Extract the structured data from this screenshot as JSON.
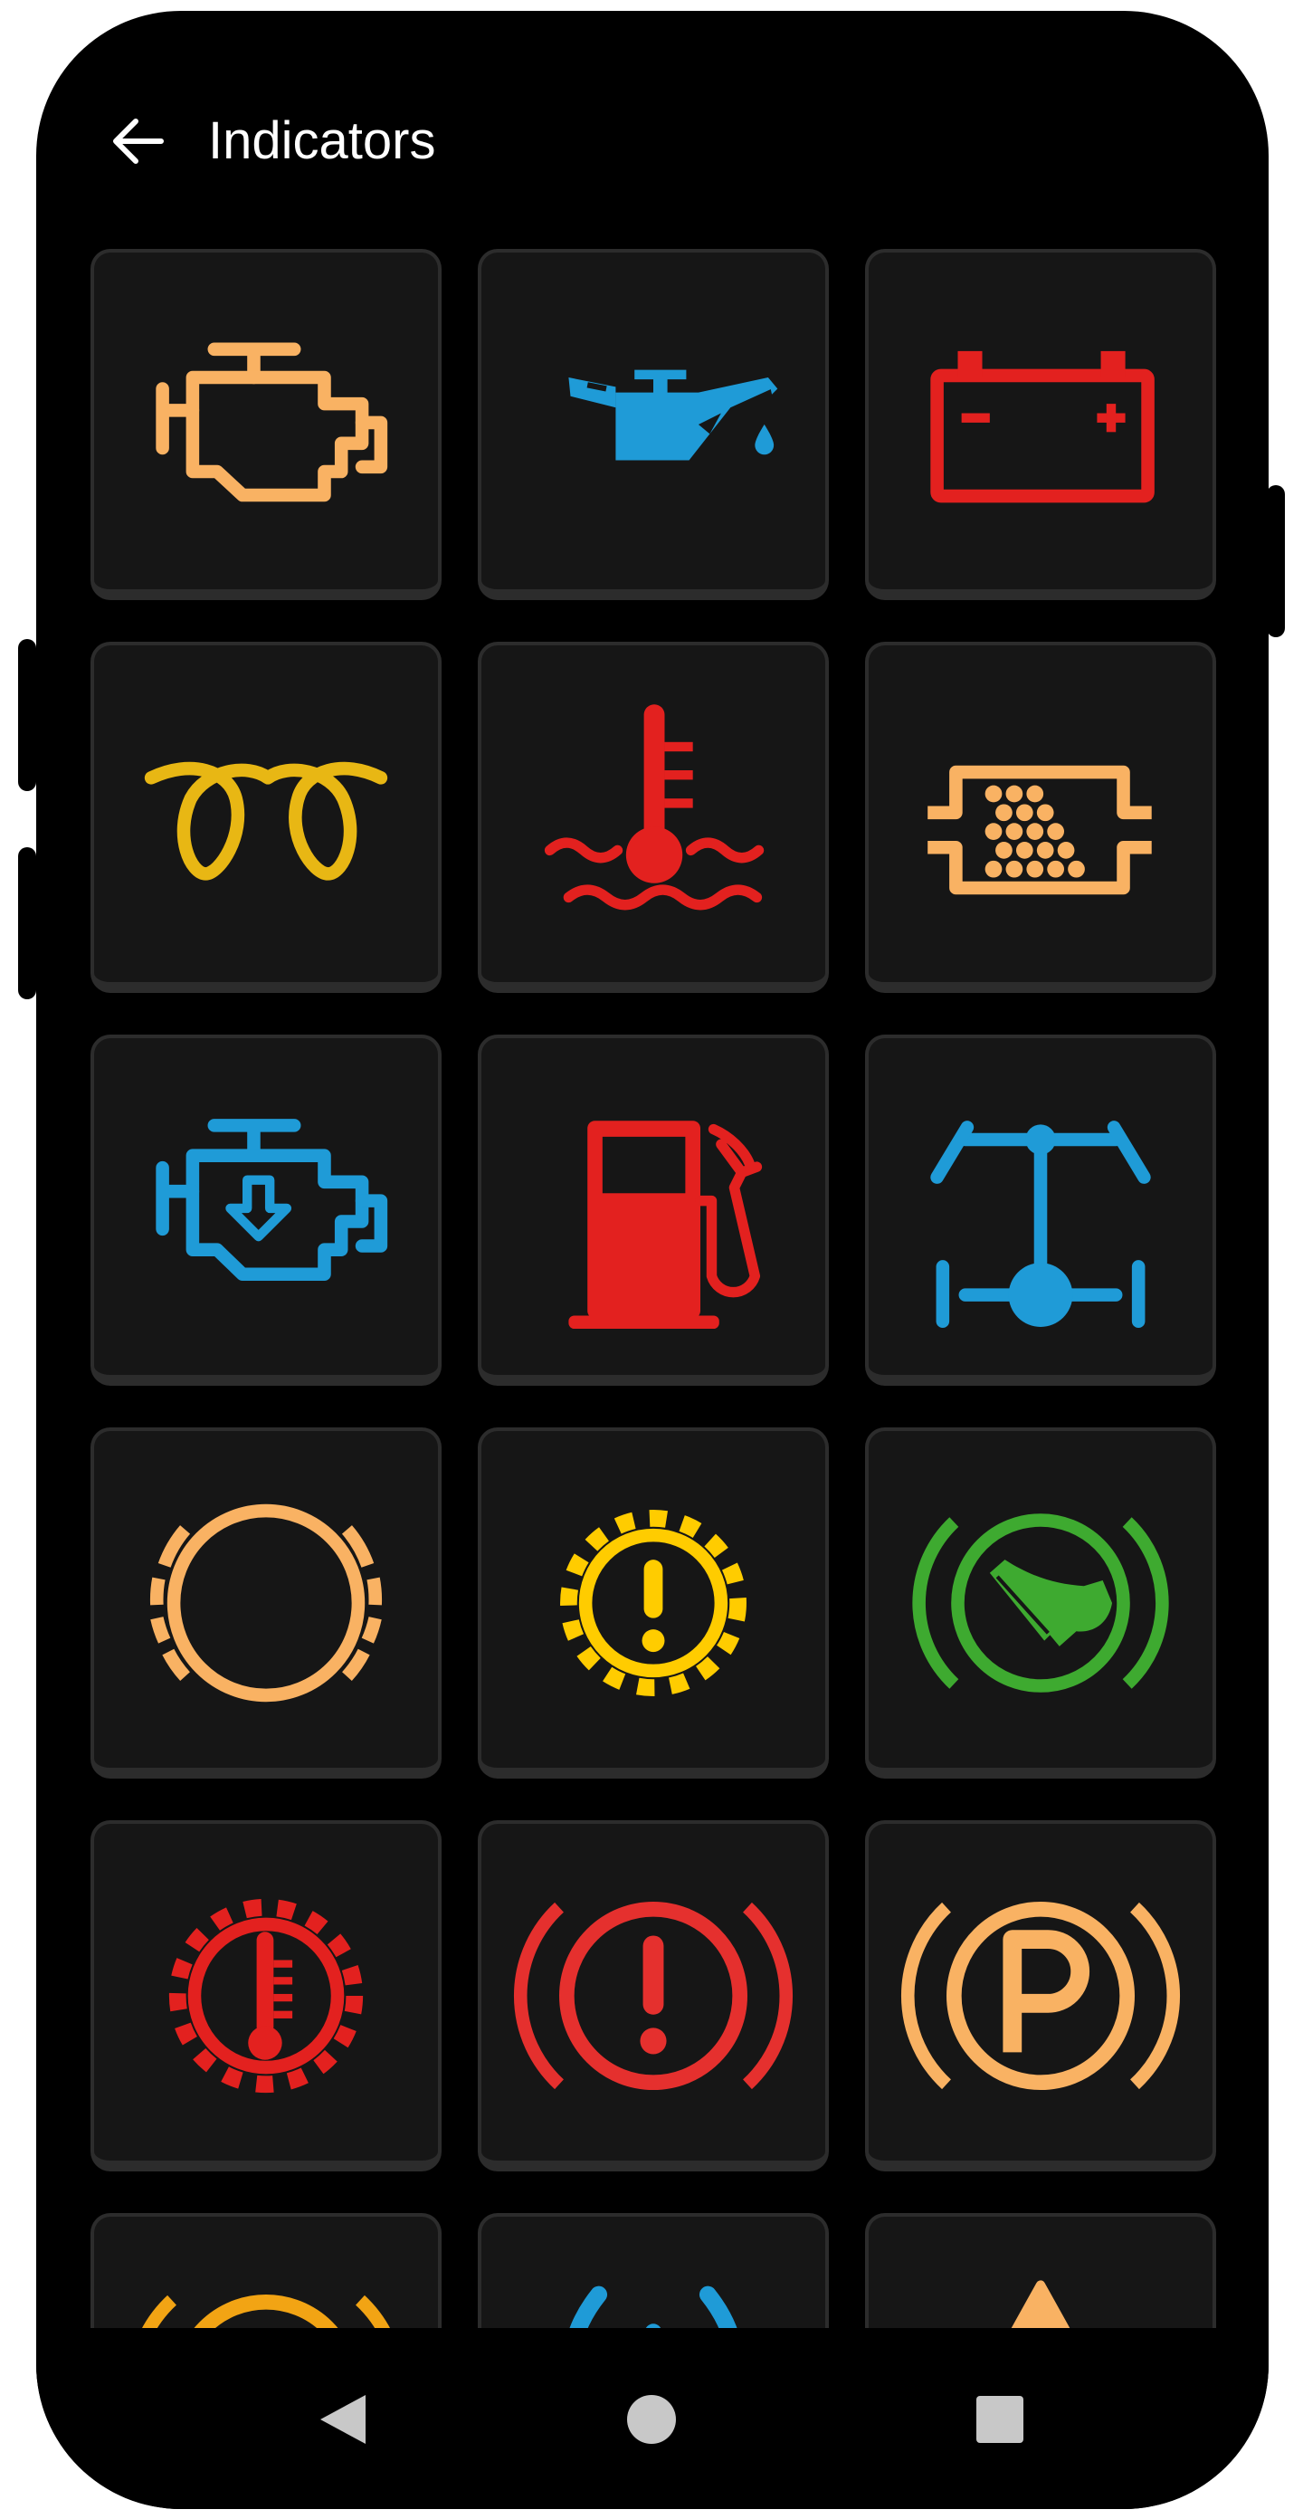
{
  "header": {
    "title": "Indicators",
    "back_icon": "arrow-left-icon"
  },
  "theme": {
    "background": "#000000",
    "tile": "#161616",
    "tile_border": "#2c2c2c"
  },
  "indicators": [
    {
      "icon": "check-engine-icon",
      "color": "#F9B263"
    },
    {
      "icon": "oil-pressure-icon",
      "color": "#1F9BD7"
    },
    {
      "icon": "battery-icon",
      "color": "#E3211F"
    },
    {
      "icon": "glow-plug-icon",
      "color": "#E8B714"
    },
    {
      "icon": "coolant-temperature-icon",
      "color": "#E3211F"
    },
    {
      "icon": "diesel-particulate-filter-icon",
      "color": "#F9B263"
    },
    {
      "icon": "engine-power-reduced-icon",
      "color": "#1F9BD7"
    },
    {
      "icon": "low-fuel-icon",
      "color": "#E3211F"
    },
    {
      "icon": "four-wheel-drive-icon",
      "color": "#1F9BD7"
    },
    {
      "icon": "brake-pad-wear-icon",
      "color": "#F9B263"
    },
    {
      "icon": "transmission-warning-icon",
      "color": "#FFCC00"
    },
    {
      "icon": "parking-brake-service-icon",
      "color": "#3EAA30"
    },
    {
      "icon": "transmission-temperature-icon",
      "color": "#E3211F"
    },
    {
      "icon": "brake-warning-icon",
      "color": "#E5302E"
    },
    {
      "icon": "parking-brake-icon",
      "color": "#F9B263"
    },
    {
      "icon": "abs-icon",
      "color": "#F2A414"
    },
    {
      "icon": "tire-pressure-icon",
      "color": "#1F9BD7"
    },
    {
      "icon": "master-warning-icon",
      "color": "#F9B263"
    }
  ],
  "nav": {
    "back": "nav-back-icon",
    "home": "nav-home-icon",
    "recents": "nav-recents-icon",
    "icon_color": "#c8c8c8"
  }
}
